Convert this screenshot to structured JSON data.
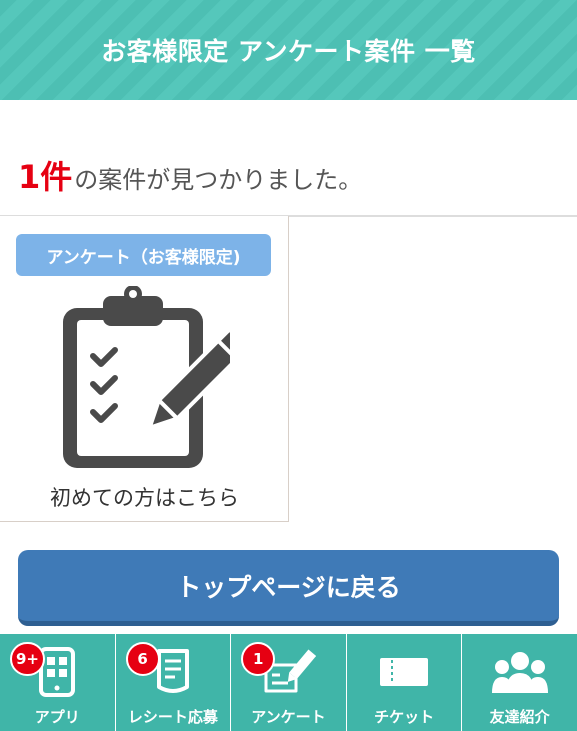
{
  "header": {
    "title": "お客様限定 アンケート案件 一覧"
  },
  "result": {
    "count": "1件",
    "text": "の案件が見つかりました。"
  },
  "card": {
    "badge": "アンケート（お客様限定)",
    "icon": "clipboard-checklist-pencil-icon",
    "caption": "初めての方はこちら"
  },
  "top_button": {
    "label": "トップページに戻る"
  },
  "tabbar": {
    "items": [
      {
        "label": "アプリ",
        "icon": "smartphone-app-icon",
        "badge": "9+"
      },
      {
        "label": "レシート応募",
        "icon": "receipt-icon",
        "badge": "6"
      },
      {
        "label": "アンケート",
        "icon": "survey-pen-icon",
        "badge": "1"
      },
      {
        "label": "チケット",
        "icon": "ticket-icon",
        "badge": ""
      },
      {
        "label": "友達紹介",
        "icon": "friends-group-icon",
        "badge": ""
      }
    ]
  },
  "colors": {
    "header_teal": "#4dbfb3",
    "accent_red": "#e60012",
    "badge_blue": "#7db3e8",
    "button_blue": "#3f7ab7",
    "tabbar_teal": "#40b5a8"
  }
}
